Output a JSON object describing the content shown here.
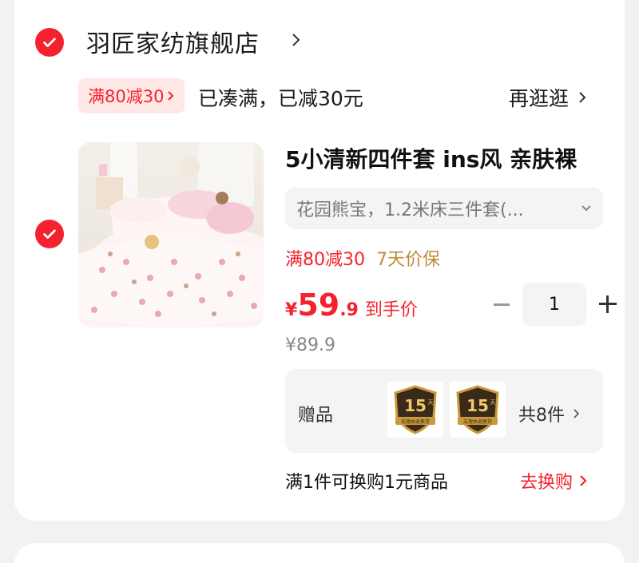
{
  "store": {
    "name": "羽匠家纺旗舰店"
  },
  "promo": {
    "tag": "满80减30",
    "status": "已凑满，已减30元",
    "browse": "再逛逛"
  },
  "product": {
    "title": "5小清新四件套 ins风 亲肤裸",
    "sku": "花园熊宝，1.2米床三件套(...",
    "tags": [
      "满80减30",
      "7天价保"
    ],
    "price": {
      "currency": "¥",
      "integer": "59",
      "decimal": ".9",
      "label": "到手价"
    },
    "original_price": "¥89.9",
    "quantity": "1"
  },
  "gift": {
    "label": "赠品",
    "badge_number": "15",
    "badge_unit": "天",
    "badge_text": "无理由退换货",
    "count": "共8件"
  },
  "exchange": {
    "text": "满1件可换购1元商品",
    "button": "去换购"
  },
  "colors": {
    "accent": "#f5222d",
    "gold": "#c08a3a"
  }
}
